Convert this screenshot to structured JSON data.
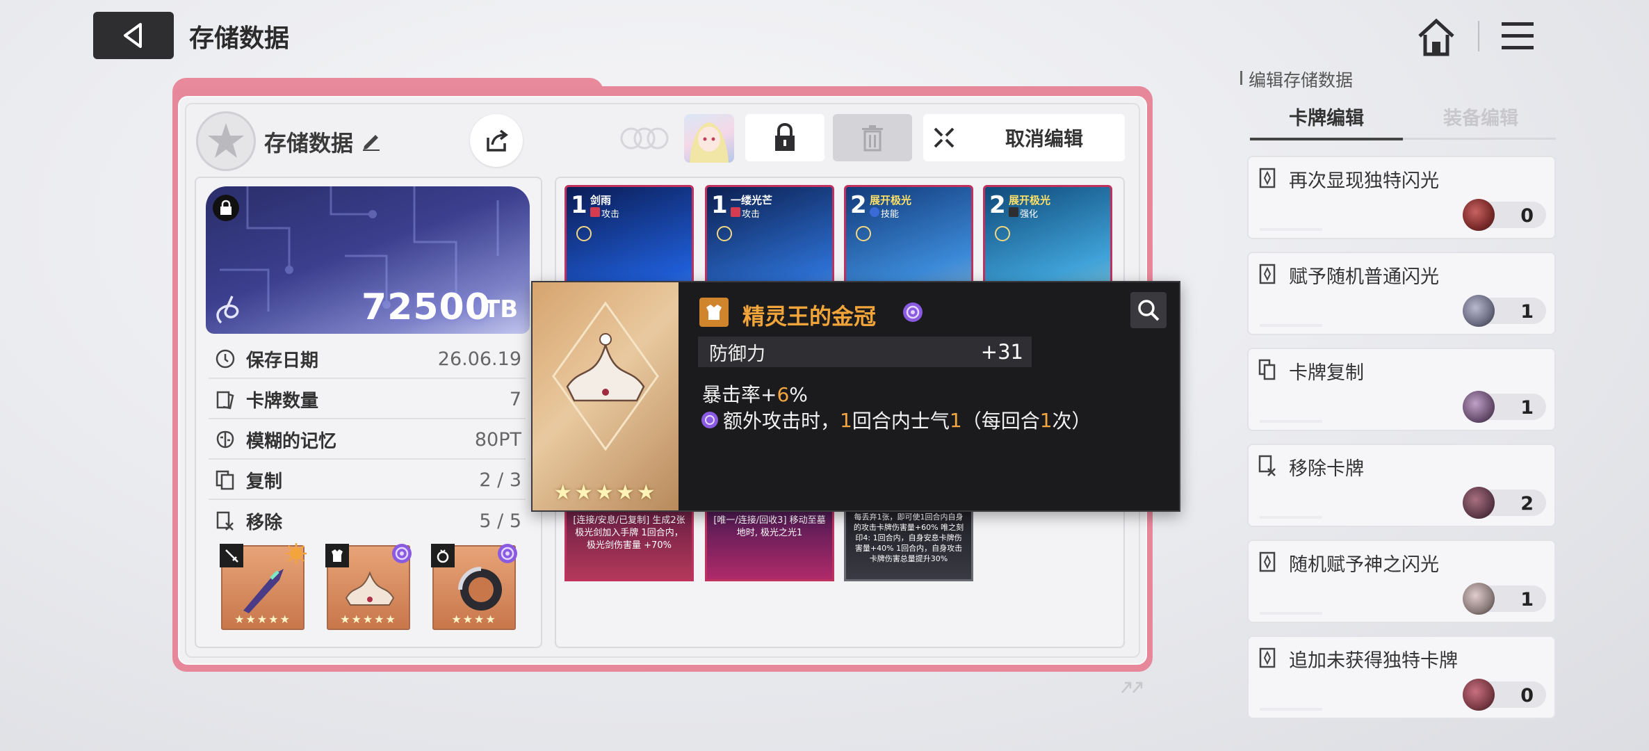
{
  "header": {
    "title": "存储数据"
  },
  "panel": {
    "save_name": "存储数据",
    "cancel_label": "取消编辑",
    "tb_value": "72500",
    "tb_unit": "TB",
    "stats": [
      {
        "icon": "clock-icon",
        "label": "保存日期",
        "value": "26.06.19"
      },
      {
        "icon": "cards-icon",
        "label": "卡牌数量",
        "value": "7"
      },
      {
        "icon": "brain-icon",
        "label": "模糊的记忆",
        "value": "80PT"
      },
      {
        "icon": "copy-icon",
        "label": "复制",
        "value": "2 / 3"
      },
      {
        "icon": "remove-icon",
        "label": "移除",
        "value": "5 / 5"
      }
    ],
    "equipment": [
      {
        "slot": "weapon",
        "stars": "★★★★★",
        "rarity_color": "#f3a43b"
      },
      {
        "slot": "armor",
        "stars": "★★★★★",
        "rarity_color": "#8a5be0"
      },
      {
        "slot": "accessory",
        "stars": "★★★★",
        "rarity_color": "#8a5be0"
      }
    ]
  },
  "cards": [
    {
      "cost": "1",
      "name": "剑雨",
      "type": "攻击",
      "name_color": "#ffffff"
    },
    {
      "cost": "1",
      "name": "一缕光芒",
      "type": "攻击",
      "name_color": "#ffffff"
    },
    {
      "cost": "2",
      "name": "展开极光",
      "type": "技能",
      "name_color": "#ffe066"
    },
    {
      "cost": "2",
      "name": "展开极光",
      "type": "强化",
      "name_color": "#ffe066"
    }
  ],
  "card_bottoms": [
    {
      "text": "[连接/安息/已复制] 生成2张极光剑加入手牌 1回合内，极光剑伤害量 +70%"
    },
    {
      "text": "[唯一/连接/回收3] 移动至墓地时, 极光之光1"
    },
    {
      "text": "每丢弃1张，即可使1回合内自身的攻击卡牌伤害量+60% 唯之刻印4: 1回合内，自身安息卡牌伤害量+40% 1回合内，自身攻击卡牌伤害总量提升30%"
    }
  ],
  "tooltip": {
    "title": "精灵王的金冠",
    "stat_label": "防御力",
    "stat_value": "+31",
    "line1_prefix": "暴击率+",
    "line1_num": "6",
    "line1_suffix": "%",
    "line2_a": "额外攻击时，",
    "line2_b": "1",
    "line2_c": "回合内士气",
    "line2_d": "1",
    "line2_e": "（每回合",
    "line2_f": "1",
    "line2_g": "次）",
    "stars": "★★★★★",
    "rarity_color": "#8a5be0"
  },
  "sidebar": {
    "title": "编辑存储数据",
    "tabs": [
      {
        "label": "卡牌编辑"
      },
      {
        "label": "装备编辑"
      }
    ],
    "items": [
      {
        "label": "再次显现独特闪光",
        "count": "0",
        "avatar_color": "#7a2a2a"
      },
      {
        "label": "赋予随机普通闪光",
        "count": "1",
        "avatar_color": "#6a6a80"
      },
      {
        "label": "卡牌复制",
        "count": "1",
        "avatar_color": "#6a5070"
      },
      {
        "label": "移除卡牌",
        "count": "2",
        "avatar_color": "#5e3a48"
      },
      {
        "label": "随机赋予神之闪光",
        "count": "1",
        "avatar_color": "#8a7a7a"
      },
      {
        "label": "追加未获得独特卡牌",
        "count": "0",
        "avatar_color": "#7a3a44"
      }
    ]
  }
}
